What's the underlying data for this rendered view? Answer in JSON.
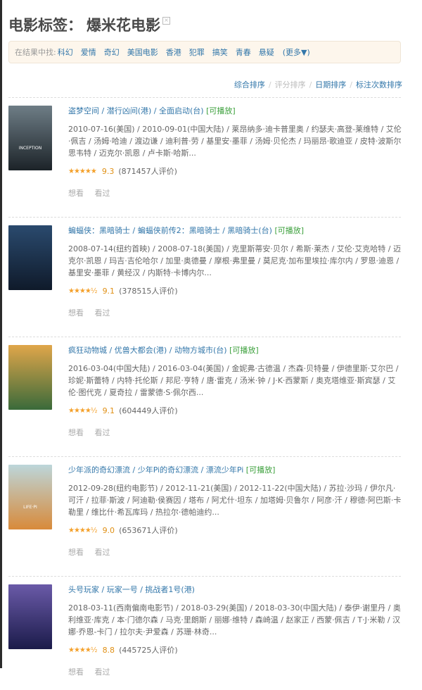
{
  "header": {
    "title": "电影标签：",
    "tag": "爆米花电影",
    "close_glyph": "×"
  },
  "filter": {
    "label": "在结果中找:",
    "items": [
      "科幻",
      "爱情",
      "奇幻",
      "美国电影",
      "香港",
      "犯罪",
      "搞笑",
      "青春",
      "悬疑"
    ],
    "more": "(更多▼)"
  },
  "sort": {
    "items": [
      "综合排序",
      "评分排序",
      "日期排序",
      "标注次数排序"
    ]
  },
  "actions": {
    "want": "想看",
    "seen": "看过"
  },
  "movies": [
    {
      "titles": "盗梦空间 / 潜行凶间(港) / 全面启动(台)",
      "playable": "[可播放]",
      "details": "2010-07-16(美国) / 2010-09-01(中国大陆) / 莱昂纳多·迪卡普里奥 / 约瑟夫·高登-莱维特 / 艾伦·佩吉 / 汤姆·哈迪 / 渡边谦 / 迪利普·劳 / 基里安·墨菲 / 汤姆·贝伦杰 / 玛丽昂·歌迪亚 / 皮特·波斯尔思韦特 / 迈克尔·凯恩 / 卢卡斯·哈斯...",
      "stars": "★★★★★",
      "score": "9.3",
      "votes": "(871457人评价)",
      "poster_text": "INCEPTION",
      "poster_colors": [
        "#6e7d86",
        "#1c2328"
      ]
    },
    {
      "titles": "蝙蝠侠：黑暗骑士 / 蝙蝠侠前传2：黑暗骑士 / 黑暗骑士(台)",
      "playable": "[可播放]",
      "details": "2008-07-14(纽约首映) / 2008-07-18(美国) / 克里斯蒂安·贝尔 / 希斯·莱杰 / 艾伦·艾克哈特 / 迈克尔·凯恩 / 玛吉·吉伦哈尔 / 加里·奥德曼 / 摩根·弗里曼 / 莫尼克·加布里埃拉·库尔内 / 罗恩·迪恩 / 基里安·墨菲 / 黄经汉 / 内斯特·卡博内尔...",
      "stars": "★★★★½",
      "score": "9.1",
      "votes": "(378515人评价)",
      "poster_text": "",
      "poster_colors": [
        "#2a4a6e",
        "#0f1a2a"
      ]
    },
    {
      "titles": "疯狂动物城 / 优兽大都会(港) / 动物方城市(台)",
      "playable": "[可播放]",
      "details": "2016-03-04(中国大陆) / 2016-03-04(美国) / 金妮弗·古德温 / 杰森·贝特曼 / 伊德里斯·艾尔巴 / 珍妮·斯蕾特 / 内特·托伦斯 / 邦尼·亨特 / 唐·雷克 / 汤米·钟 / J·K·西蒙斯 / 奥克塔维亚·斯宾瑟 / 艾伦·图代克 / 夏奇拉 / 雷蒙德·S·佩尔西...",
      "stars": "★★★★½",
      "score": "9.1",
      "votes": "(604449人评价)",
      "poster_text": "",
      "poster_colors": [
        "#e0a64a",
        "#3a6a3a"
      ]
    },
    {
      "titles": "少年派的奇幻漂流 / 少年Pi的奇幻漂流 / 漂流少年Pi",
      "playable": "[可播放]",
      "details": "2012-09-28(纽约电影节) / 2012-11-21(美国) / 2012-11-22(中国大陆) / 苏拉·沙玛 / 伊尔凡·可汗 / 拉菲·斯波 / 阿迪勒·侯赛因 / 塔布 / 阿尤什·坦东 / 加塔姆·贝鲁尔 / 阿彦·汗 / 穆德·阿巴斯·卡勒里 / 维比什·希瓦库玛 / 热拉尔·德帕迪约...",
      "stars": "★★★★½",
      "score": "9.0",
      "votes": "(653671人评价)",
      "poster_text": "LIFE·PI",
      "poster_colors": [
        "#bcd6da",
        "#d88a3a"
      ]
    },
    {
      "titles": "头号玩家 / 玩家一号 / 挑战者1号(港)",
      "playable": "",
      "details": "2018-03-11(西南偏南电影节) / 2018-03-29(美国) / 2018-03-30(中国大陆) / 泰伊·谢里丹 / 奥利维亚·库克 / 本·门德尔森 / 马克·里朗斯 / 丽娜·维特 / 森崎温 / 赵家正 / 西蒙·佩吉 / T·J·米勒 / 汉娜·乔恩-卡门 / 拉尔夫·尹爱森 / 苏珊·林奇...",
      "stars": "★★★★½",
      "score": "8.8",
      "votes": "(445725人评价)",
      "poster_text": "",
      "poster_colors": [
        "#6a5aa8",
        "#1b1b4a"
      ]
    }
  ]
}
